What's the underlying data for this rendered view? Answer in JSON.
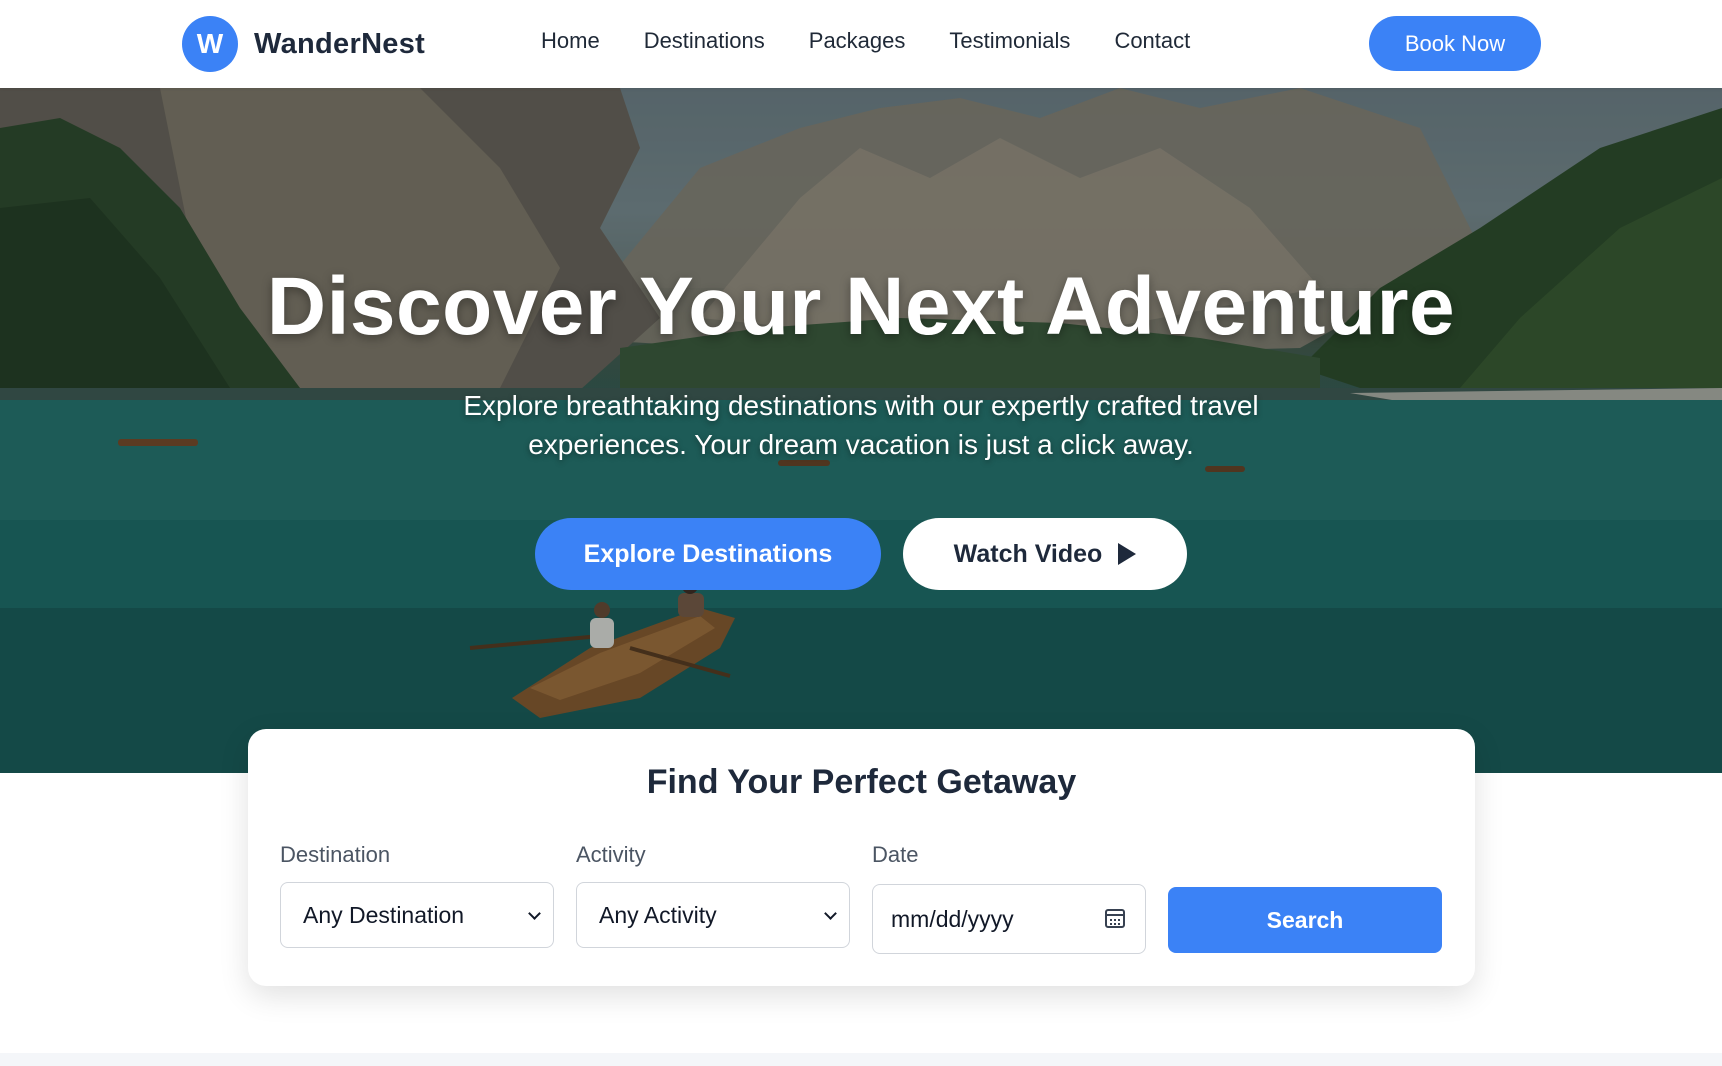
{
  "brand": {
    "logo_letter": "W",
    "name": "WanderNest"
  },
  "nav": {
    "links": [
      {
        "label": "Home"
      },
      {
        "label": "Destinations"
      },
      {
        "label": "Packages"
      },
      {
        "label": "Testimonials"
      },
      {
        "label": "Contact"
      }
    ],
    "cta_label": "Book Now"
  },
  "hero": {
    "title": "Discover Your Next Adventure",
    "subtitle": "Explore breathtaking destinations with our expertly crafted travel experiences. Your dream vacation is just a click away.",
    "primary_button": "Explore Destinations",
    "secondary_button": "Watch Video"
  },
  "search": {
    "title": "Find Your Perfect Getaway",
    "destination": {
      "label": "Destination",
      "value": "Any Destination"
    },
    "activity": {
      "label": "Activity",
      "value": "Any Activity"
    },
    "date": {
      "label": "Date",
      "placeholder": "mm/dd/yyyy"
    },
    "button_label": "Search"
  },
  "colors": {
    "accent": "#3b82f6",
    "heading": "#1e293b",
    "nav_bg": "#ffffff"
  },
  "icons": {
    "play": "play-icon",
    "chevron": "chevron-down-icon",
    "calendar": "calendar-icon"
  }
}
